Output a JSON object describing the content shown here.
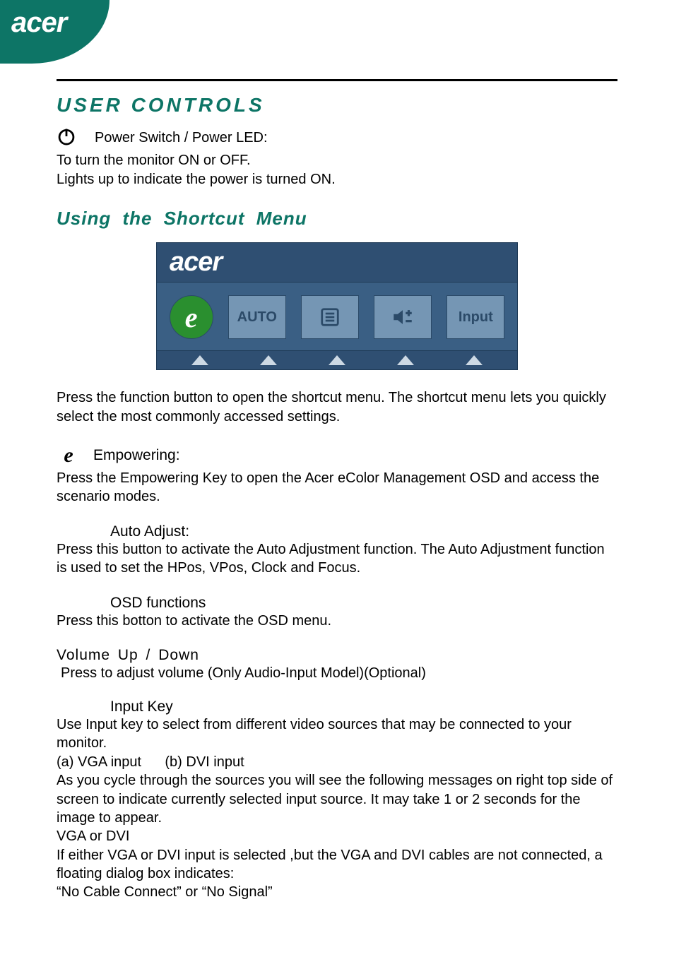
{
  "brand": "acer",
  "headings": {
    "user_controls": "USER CONTROLS",
    "shortcut_menu": "Using   the  Shortcut  Menu"
  },
  "power": {
    "label": "Power Switch / Power LED:",
    "line1": "To turn the monitor ON or OFF.",
    "line2": "Lights up to indicate the power is turned ON."
  },
  "osd": {
    "brand": "acer",
    "auto": "AUTO",
    "input": "Input"
  },
  "shortcut_desc": "Press the function button to open the shortcut menu. The shortcut menu lets you quickly select the most commonly accessed settings.",
  "empowering": {
    "title": "Empowering:",
    "body": "Press the Empowering Key to open the Acer eColor Management OSD and access the scenario modes."
  },
  "auto_adjust": {
    "title": "Auto Adjust:",
    "body": "Press this button to activate the Auto Adjustment function. The Auto Adjustment function is used to set the HPos, VPos, Clock and Focus."
  },
  "osd_functions": {
    "title": "OSD functions",
    "body": "Press this botton to activate the OSD menu."
  },
  "volume": {
    "title": "Volume  Up  /  Down",
    "body": "Press to adjust volume (Only Audio-Input Model)(Optional)"
  },
  "input_key": {
    "title": "Input Key",
    "p1": "Use Input key to select from different video sources that may be connected to your monitor.",
    "p2": "(a) VGA input      (b) DVI input",
    "p3": "As you cycle through the sources you will see the following messages on right top side of screen to indicate currently selected input source. It may take 1 or 2 seconds for the image to appear.",
    "p4": "VGA   or  DVI",
    "p5": "If either VGA or DVI input is selected ,but the VGA and DVI cables are not connected, a floating dialog box indicates:",
    "p6": "“No Cable Connect” or “No Signal”"
  }
}
